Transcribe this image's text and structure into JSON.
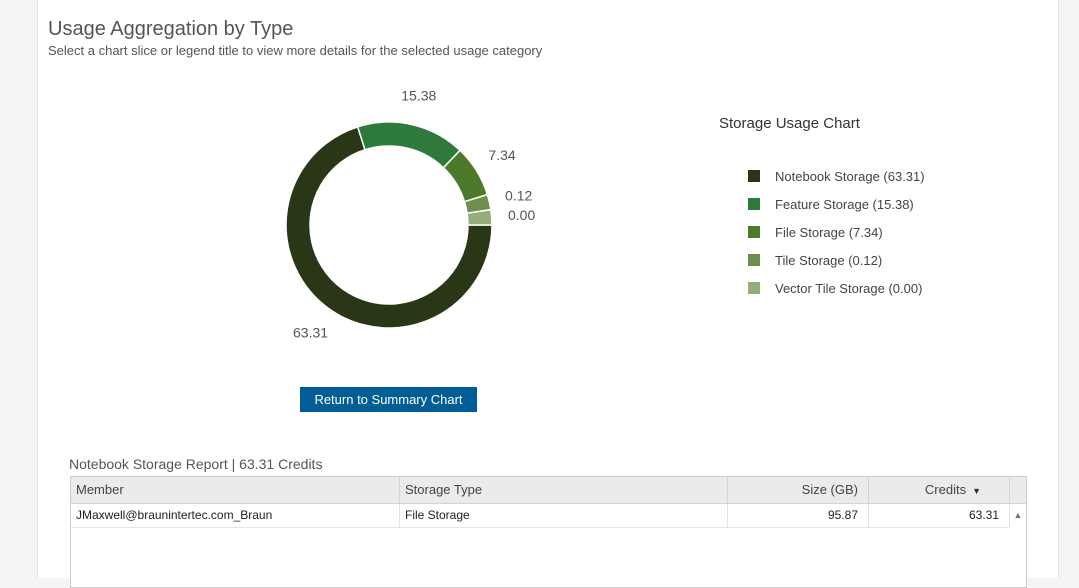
{
  "header": {
    "title": "Usage Aggregation by Type",
    "subtitle": "Select a chart slice or legend title to view more details for the selected usage category"
  },
  "chart_data": {
    "type": "pie",
    "title": "Storage Usage Chart",
    "donut": true,
    "legend_position": "right",
    "series": [
      {
        "name": "Notebook Storage (63.31)",
        "value": 63.31,
        "label": "63.31",
        "color": "#293716"
      },
      {
        "name": "Feature Storage (15.38)",
        "value": 15.38,
        "label": "15.38",
        "color": "#2e7a3d"
      },
      {
        "name": "File Storage (7.34)",
        "value": 7.34,
        "label": "7.34",
        "color": "#4d7a2a"
      },
      {
        "name": "Tile Storage (0.12)",
        "value": 0.12,
        "label": "0.12",
        "color": "#6e8e4e"
      },
      {
        "name": "Vector Tile Storage (0.00)",
        "value": 0.0,
        "label": "0.00",
        "color": "#93ad7c"
      }
    ]
  },
  "actions": {
    "return_button": "Return to Summary Chart"
  },
  "report": {
    "title": "Notebook Storage Report | 63.31 Credits",
    "columns": [
      "Member",
      "Storage Type",
      "Size (GB)",
      "Credits"
    ],
    "rows": [
      [
        "JMaxwell@braunintertec.com_Braun",
        "File Storage",
        "95.87",
        "63.31"
      ]
    ]
  }
}
